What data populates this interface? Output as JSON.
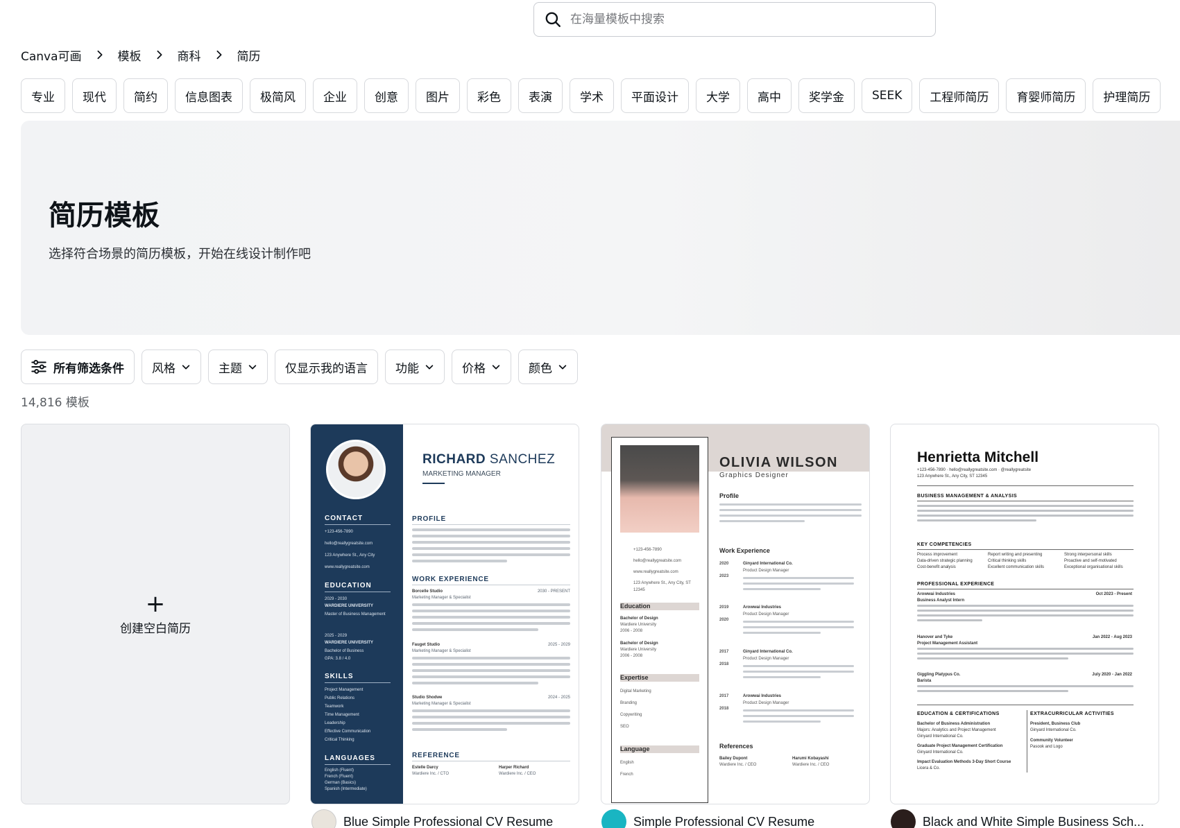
{
  "search": {
    "placeholder": "在海量模板中搜索"
  },
  "breadcrumb": [
    "Canva可画",
    "模板",
    "商科",
    "简历"
  ],
  "categories": [
    "专业",
    "现代",
    "简约",
    "信息图表",
    "极简风",
    "企业",
    "创意",
    "图片",
    "彩色",
    "表演",
    "学术",
    "平面设计",
    "大学",
    "高中",
    "奖学金",
    "SEEK",
    "工程师简历",
    "育婴师简历",
    "护理简历"
  ],
  "hero": {
    "title": "简历模板",
    "subtitle": "选择符合场景的简历模板，开始在线设计制作吧"
  },
  "filters": {
    "all": "所有筛选条件",
    "style": "风格",
    "theme": "主题",
    "my_language": "仅显示我的语言",
    "feature": "功能",
    "price": "价格",
    "color": "颜色"
  },
  "count": "14,816 模板",
  "blank_card": {
    "label": "创建空白简历"
  },
  "templates": [
    {
      "title": "Blue Simple Professional CV Resume",
      "preview": {
        "first_name": "RICHARD",
        "last_name": "SANCHEZ",
        "role": "MARKETING MANAGER",
        "side_sections": [
          "CONTACT",
          "EDUCATION",
          "SKILLS",
          "LANGUAGES"
        ],
        "contact": [
          "+123-456-7890",
          "hello@reallygreatsite.com",
          "123 Anywhere St., Any City",
          "www.reallygreatsite.com"
        ],
        "education": [
          "2029 - 2030",
          "WARDIERE UNIVERSITY",
          "Master of Business Management",
          "2025 - 2029",
          "WARDIERE UNIVERSITY",
          "Bachelor of Business",
          "GPA: 3.8 / 4.0"
        ],
        "skills": [
          "Project Management",
          "Public Relations",
          "Teamwork",
          "Time Management",
          "Leadership",
          "Effective Communication",
          "Critical Thinking"
        ],
        "languages": [
          "English (Fluent)",
          "French (Fluent)",
          "German (Basics)",
          "Spanish (Intermediate)"
        ],
        "main_sections": [
          "PROFILE",
          "WORK EXPERIENCE",
          "REFERENCE"
        ],
        "jobs": [
          {
            "company": "Borcelle Studio",
            "role": "Marketing Manager & Specialist",
            "dates": "2030 - PRESENT"
          },
          {
            "company": "Fauget Studio",
            "role": "Marketing Manager & Specialist",
            "dates": "2025 - 2029"
          },
          {
            "company": "Studio Shodwe",
            "role": "Marketing Manager & Specialist",
            "dates": "2024 - 2025"
          }
        ],
        "references": [
          {
            "name": "Estelle Darcy",
            "role": "Wardiere Inc. / CTO"
          },
          {
            "name": "Harper Richard",
            "role": "Wardiere Inc. / CEO"
          }
        ]
      }
    },
    {
      "title": "Simple Professional CV Resume",
      "preview": {
        "name": "OLIVIA WILSON",
        "role": "Graphics Designer",
        "sections": [
          "Profile",
          "Work Experience",
          "References"
        ],
        "side_sections": [
          "Education",
          "Expertise",
          "Language"
        ],
        "contact": [
          "+123-456-7890",
          "hello@reallygreatsite.com",
          "www.reallygreatsite.com",
          "123 Anywhere St., Any City, ST 12345"
        ],
        "education": [
          "Bachelor of Design",
          "Wardiere University",
          "2006 - 2008",
          "Bachelor of Design",
          "Wardiere University",
          "2006 - 2008"
        ],
        "expertise": [
          "Digital Marketing",
          "Branding",
          "Copywriting",
          "SEO"
        ],
        "languages": [
          "English",
          "French"
        ],
        "jobs": [
          {
            "company": "Ginyard International Co.",
            "role": "Product Design Manager",
            "years": [
              "2020",
              "2023"
            ]
          },
          {
            "company": "Arowwai Industries",
            "role": "Product Design Manager",
            "years": [
              "2019",
              "2020"
            ]
          },
          {
            "company": "Ginyard International Co.",
            "role": "Product Design Manager",
            "years": [
              "2017",
              "2018"
            ]
          },
          {
            "company": "Arowwai Industries",
            "role": "Product Design Manager",
            "years": [
              "2017",
              "2018"
            ]
          }
        ],
        "references": [
          {
            "name": "Bailey Dupont",
            "role": "Wardiere Inc. / CEO"
          },
          {
            "name": "Harumi Kobayashi",
            "role": "Wardiere Inc. / CEO"
          }
        ]
      }
    },
    {
      "title": "Black and White Simple Business Sch...",
      "preview": {
        "name": "Henrietta Mitchell",
        "contact": "+123-456-7890 · hello@reallygreatsite.com · @reallygreatsite",
        "address": "123 Anywhere St., Any City, ST 12345",
        "sections": [
          "BUSINESS MANAGEMENT & ANALYSIS",
          "KEY COMPETENCIES",
          "PROFESSIONAL EXPERIENCE",
          "EDUCATION & CERTIFICATIONS",
          "EXTRACURRICULAR ACTIVITIES"
        ],
        "competencies": [
          "Process improvement",
          "Report writing and presenting",
          "Strong interpersonal skills",
          "Data-driven strategic planning",
          "Critical thinking skills",
          "Proactive and self-motivated",
          "Cost-benefit analysis",
          "Excellent communication skills",
          "Exceptional organisational skills"
        ],
        "jobs": [
          {
            "company": "Arowwai Industries",
            "role": "Business Analyst Intern",
            "dates": "Oct 2023 - Present"
          },
          {
            "company": "Hanover and Tyke",
            "role": "Project Management Assistant",
            "dates": "Jan 2022 - Aug 2023"
          },
          {
            "company": "Giggling Platypus Co.",
            "role": "Barista",
            "dates": "July 2020 - Jan 2022"
          }
        ],
        "education": [
          "Bachelor of Business Administration",
          "Majors: Analytics and Project Management",
          "Ginyard International Co.",
          "Graduate Project Management Certification",
          "Ginyard International Co.",
          "Impact Evaluation Methods 3-Day Short Course",
          "Licera & Co."
        ],
        "extracurricular": [
          "President, Business Club",
          "Ginyard International Co.",
          "Community Volunteer",
          "Pasook and Logo"
        ]
      }
    }
  ],
  "colors": {
    "resume_navy": "#1d3a5a",
    "resume_taupe": "#ddd6d3",
    "hero_bg": "#f2f3f5",
    "blank_card_bg": "#f0f1f3"
  },
  "icons": [
    "search-icon",
    "chevron-right-icon",
    "sliders-icon",
    "chevron-down-icon",
    "plus-icon"
  ]
}
